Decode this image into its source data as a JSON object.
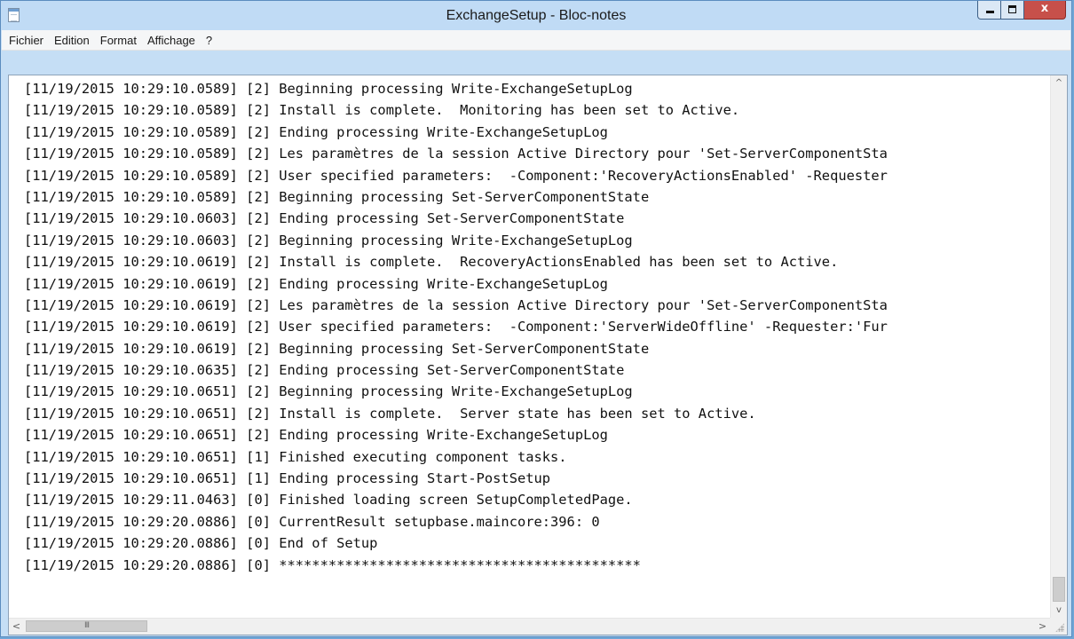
{
  "window": {
    "title": "ExchangeSetup - Bloc-notes",
    "close_glyph": "x"
  },
  "menu": [
    "Fichier",
    "Edition",
    "Format",
    "Affichage",
    "?"
  ],
  "lines": [
    "[11/19/2015 10:29:10.0589] [2] Beginning processing Write-ExchangeSetupLog",
    "[11/19/2015 10:29:10.0589] [2] Install is complete.  Monitoring has been set to Active.",
    "[11/19/2015 10:29:10.0589] [2] Ending processing Write-ExchangeSetupLog",
    "[11/19/2015 10:29:10.0589] [2] Les paramètres de la session Active Directory pour 'Set-ServerComponentSta",
    "[11/19/2015 10:29:10.0589] [2] User specified parameters:  -Component:'RecoveryActionsEnabled' -Requester",
    "[11/19/2015 10:29:10.0589] [2] Beginning processing Set-ServerComponentState",
    "[11/19/2015 10:29:10.0603] [2] Ending processing Set-ServerComponentState",
    "[11/19/2015 10:29:10.0603] [2] Beginning processing Write-ExchangeSetupLog",
    "[11/19/2015 10:29:10.0619] [2] Install is complete.  RecoveryActionsEnabled has been set to Active.",
    "[11/19/2015 10:29:10.0619] [2] Ending processing Write-ExchangeSetupLog",
    "[11/19/2015 10:29:10.0619] [2] Les paramètres de la session Active Directory pour 'Set-ServerComponentSta",
    "[11/19/2015 10:29:10.0619] [2] User specified parameters:  -Component:'ServerWideOffline' -Requester:'Fur",
    "[11/19/2015 10:29:10.0619] [2] Beginning processing Set-ServerComponentState",
    "[11/19/2015 10:29:10.0635] [2] Ending processing Set-ServerComponentState",
    "[11/19/2015 10:29:10.0651] [2] Beginning processing Write-ExchangeSetupLog",
    "[11/19/2015 10:29:10.0651] [2] Install is complete.  Server state has been set to Active.",
    "[11/19/2015 10:29:10.0651] [2] Ending processing Write-ExchangeSetupLog",
    "[11/19/2015 10:29:10.0651] [1] Finished executing component tasks.",
    "[11/19/2015 10:29:10.0651] [1] Ending processing Start-PostSetup",
    "[11/19/2015 10:29:11.0463] [0] Finished loading screen SetupCompletedPage.",
    "[11/19/2015 10:29:20.0886] [0] CurrentResult setupbase.maincore:396: 0",
    "[11/19/2015 10:29:20.0886] [0] End of Setup",
    "[11/19/2015 10:29:20.0886] [0] ********************************************"
  ],
  "scrollbar": {
    "up_glyph": "^",
    "down_glyph": "v",
    "left_glyph": "<",
    "right_glyph": ">",
    "thumb_grip": "III"
  },
  "colors": {
    "titlebar": "#c0dbf5",
    "close_button": "#c7504a",
    "text": "#111111",
    "editor_bg": "#ffffff"
  }
}
